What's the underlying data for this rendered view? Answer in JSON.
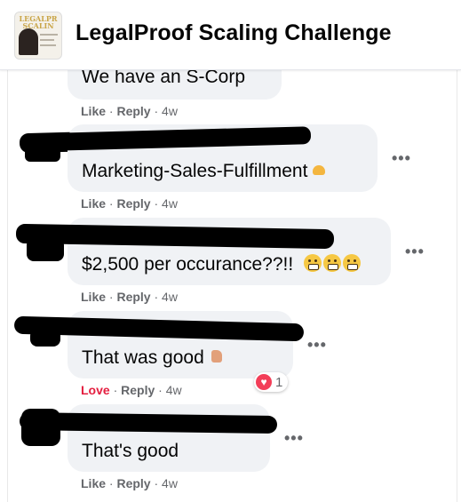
{
  "header": {
    "group_name": "LegalProof Scaling Challenge",
    "thumb_text": "LEGALPR SCALIN"
  },
  "comments": [
    {
      "text": "We have an S-Corp",
      "like": "Like",
      "reply": "Reply",
      "time": "4w"
    },
    {
      "text": "Marketing-Sales-Fulfillment",
      "emoji": "raising-hands",
      "like": "Like",
      "reply": "Reply",
      "time": "4w"
    },
    {
      "text": "$2,500 per occurance??!!",
      "emoji": "grimacing-faces",
      "like": "Like",
      "reply": "Reply",
      "time": "4w"
    },
    {
      "text": "That was good",
      "emoji": "thumbs-up",
      "like": "Love",
      "reply": "Reply",
      "time": "4w",
      "reaction": {
        "type": "love",
        "count": "1"
      }
    },
    {
      "text": "That's good",
      "like": "Like",
      "reply": "Reply",
      "time": "4w"
    }
  ],
  "more_label": "•••",
  "separator": "·",
  "colors": {
    "bubble": "#f0f2f5",
    "meta": "#65676b",
    "love": "#e41e3f",
    "heart": "#f33e58"
  }
}
